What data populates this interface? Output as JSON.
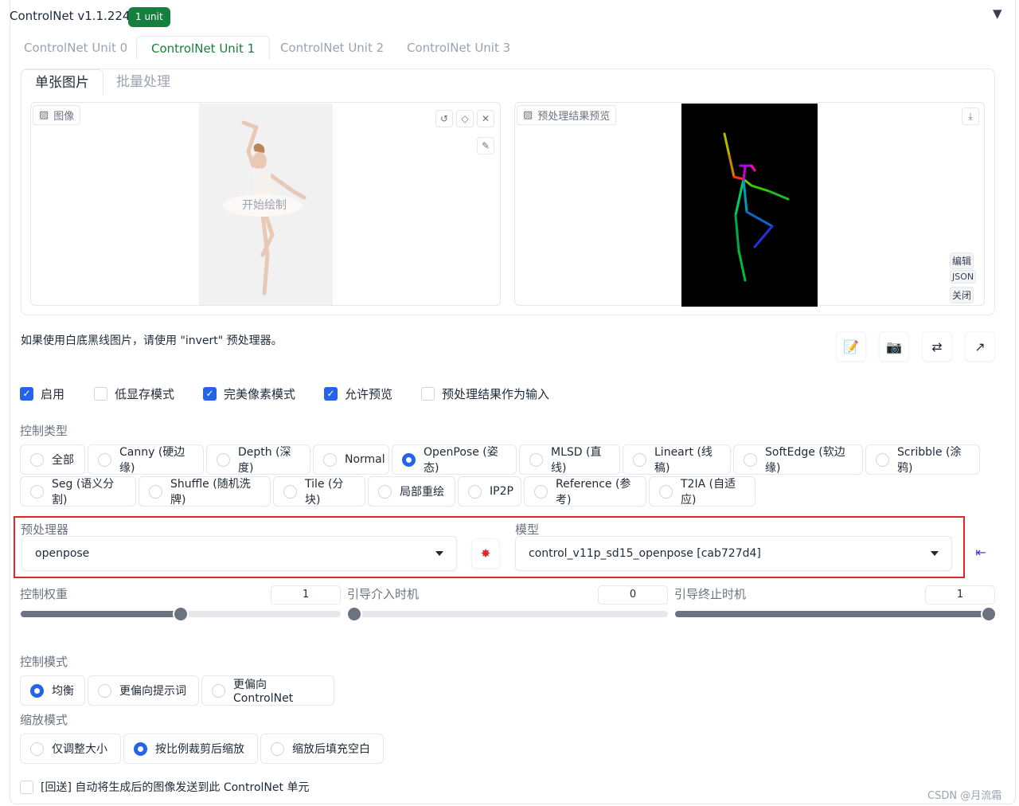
{
  "header": {
    "title": "ControlNet v1.1.224",
    "badge": "1 unit",
    "collapse_icon": "▼"
  },
  "unit_tabs": [
    "ControlNet Unit 0",
    "ControlNet Unit 1",
    "ControlNet Unit 2",
    "ControlNet Unit 3"
  ],
  "active_unit_tab": 1,
  "sub_tabs": [
    "单张图片",
    "批量处理"
  ],
  "image_panel": {
    "label": "图像",
    "overlay_text": "开始绘制"
  },
  "preview_panel": {
    "label": "预处理结果预览",
    "side_buttons": [
      "编辑",
      "JSON",
      "关闭"
    ]
  },
  "note": "如果使用白底黑线图片，请使用 \"invert\" 预处理器。",
  "checkboxes": [
    {
      "label": "启用",
      "checked": true
    },
    {
      "label": "低显存模式",
      "checked": false
    },
    {
      "label": "完美像素模式",
      "checked": true
    },
    {
      "label": "允许预览",
      "checked": true
    },
    {
      "label": "预处理结果作为输入",
      "checked": false
    }
  ],
  "control_type": {
    "label": "控制类型",
    "selected": "OpenPose (姿态)",
    "options": [
      "全部",
      "Canny (硬边缘)",
      "Depth (深度)",
      "Normal",
      "OpenPose (姿态)",
      "MLSD (直线)",
      "Lineart (线稿)",
      "SoftEdge (软边缘)",
      "Scribble (涂鸦)",
      "Seg (语义分割)",
      "Shuffle (随机洗牌)",
      "Tile (分块)",
      "局部重绘",
      "IP2P",
      "Reference (参考)",
      "T2IA (自适应)"
    ]
  },
  "preprocessor": {
    "label": "预处理器",
    "value": "openpose"
  },
  "model": {
    "label": "模型",
    "value": "control_v11p_sd15_openpose [cab727d4]"
  },
  "sliders": [
    {
      "label": "控制权重",
      "value": "1",
      "min": 0,
      "max": 2,
      "fraction": 0.5
    },
    {
      "label": "引导介入时机",
      "value": "0",
      "min": 0,
      "max": 1,
      "fraction": 0
    },
    {
      "label": "引导终止时机",
      "value": "1",
      "min": 0,
      "max": 1,
      "fraction": 1
    }
  ],
  "control_mode": {
    "label": "控制模式",
    "options": [
      "均衡",
      "更偏向提示词",
      "更偏向 ControlNet"
    ],
    "selected": "均衡"
  },
  "resize_mode": {
    "label": "缩放模式",
    "options": [
      "仅调整大小",
      "按比例裁剪后缩放",
      "缩放后填充空白"
    ],
    "selected": "按比例裁剪后缩放"
  },
  "loopback": {
    "label": "[回送] 自动将生成后的图像发送到此 ControlNet 单元",
    "checked": false
  },
  "watermark": "CSDN @月流霜",
  "colors": {
    "accent": "#2563eb",
    "tab_active": "#15803d",
    "highlight": "#e4262a"
  }
}
